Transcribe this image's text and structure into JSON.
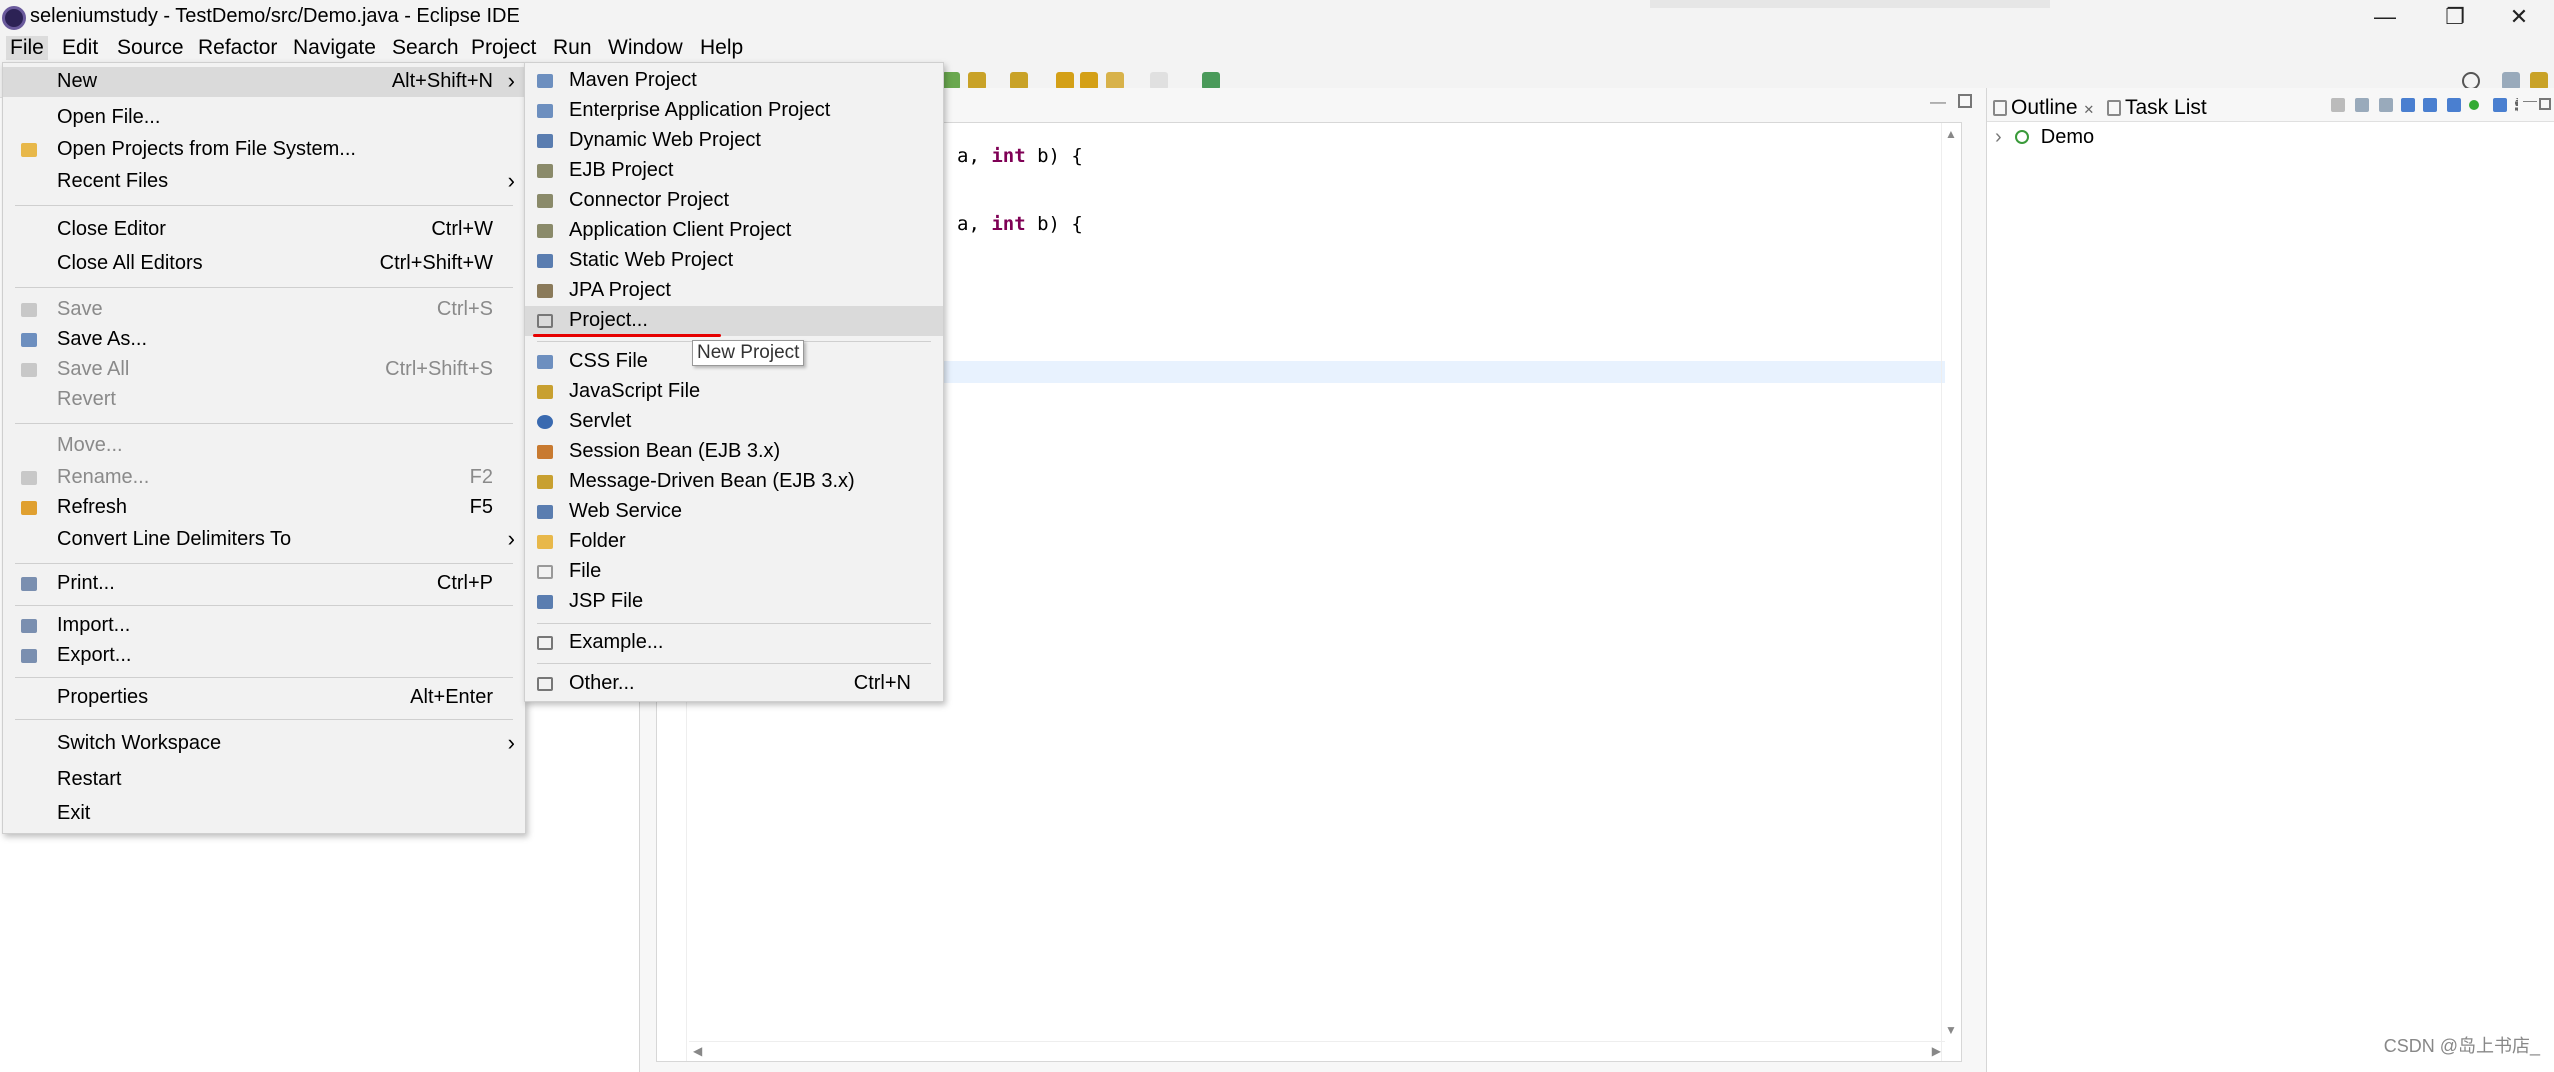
{
  "window": {
    "title": "seleniumstudy - TestDemo/src/Demo.java - Eclipse IDE",
    "minimize": "—",
    "restore": "❐",
    "close": "✕"
  },
  "menubar": [
    "File",
    "Edit",
    "Source",
    "Refactor",
    "Navigate",
    "Search",
    "Project",
    "Run",
    "Window",
    "Help"
  ],
  "file_menu": {
    "new": {
      "label": "New",
      "shortcut": "Alt+Shift+N",
      "arrow": "›"
    },
    "open_file": {
      "label": "Open File..."
    },
    "open_projects": {
      "label": "Open Projects from File System..."
    },
    "recent_files": {
      "label": "Recent Files",
      "arrow": "›"
    },
    "close_editor": {
      "label": "Close Editor",
      "shortcut": "Ctrl+W"
    },
    "close_all_editors": {
      "label": "Close All Editors",
      "shortcut": "Ctrl+Shift+W"
    },
    "save": {
      "label": "Save",
      "shortcut": "Ctrl+S"
    },
    "save_as": {
      "label": "Save As..."
    },
    "save_all": {
      "label": "Save All",
      "shortcut": "Ctrl+Shift+S"
    },
    "revert": {
      "label": "Revert"
    },
    "move": {
      "label": "Move..."
    },
    "rename": {
      "label": "Rename...",
      "shortcut": "F2"
    },
    "refresh": {
      "label": "Refresh",
      "shortcut": "F5"
    },
    "convert_line_delimiters": {
      "label": "Convert Line Delimiters To",
      "arrow": "›"
    },
    "print": {
      "label": "Print...",
      "shortcut": "Ctrl+P"
    },
    "import": {
      "label": "Import..."
    },
    "export": {
      "label": "Export..."
    },
    "properties": {
      "label": "Properties",
      "shortcut": "Alt+Enter"
    },
    "switch_workspace": {
      "label": "Switch Workspace",
      "arrow": "›"
    },
    "restart": {
      "label": "Restart"
    },
    "exit": {
      "label": "Exit"
    }
  },
  "new_menu": {
    "maven_project": "Maven Project",
    "enterprise_application_project": "Enterprise Application Project",
    "dynamic_web_project": "Dynamic Web Project",
    "ejb_project": "EJB Project",
    "connector_project": "Connector Project",
    "application_client_project": "Application Client Project",
    "static_web_project": "Static Web Project",
    "jpa_project": "JPA Project",
    "project": "Project...",
    "css_file": "CSS File",
    "javascript_file": "JavaScript File",
    "servlet": "Servlet",
    "session_bean": "Session Bean (EJB 3.x)",
    "message_driven_bean": "Message-Driven Bean (EJB 3.x)",
    "web_service": "Web Service",
    "folder": "Folder",
    "file": "File",
    "jsp_file": "JSP File",
    "example": "Example...",
    "other": "Other...",
    "other_shortcut": "Ctrl+N"
  },
  "tooltip": "New Project",
  "editor": {
    "line1": {
      "pre": "a, ",
      "kw": "int",
      "post": " b) {"
    },
    "line2": {
      "pre": "a, ",
      "kw": "int",
      "post": " b) {"
    }
  },
  "outline": {
    "tab_outline": "Outline",
    "tab_outline_close": "✕",
    "tab_task_list": "Task List",
    "tree_item": "Demo",
    "tree_arrow": "›"
  },
  "scroll": {
    "up": "▲",
    "down": "▼",
    "left": "◀",
    "right": "▶"
  },
  "watermark": "CSDN @岛上书店_",
  "colors": {
    "keyword": "#7f0055",
    "red_underline": "#e60000",
    "menu_bg": "#f2f2f2",
    "hover": "#dadada"
  }
}
